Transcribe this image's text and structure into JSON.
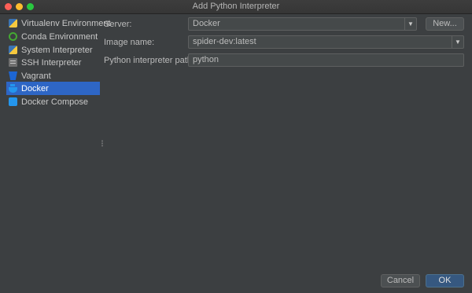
{
  "window": {
    "title": "Add Python Interpreter"
  },
  "sidebar": {
    "items": [
      {
        "label": "Virtualenv Environment",
        "icon": "python-icon"
      },
      {
        "label": "Conda Environment",
        "icon": "conda-icon"
      },
      {
        "label": "System Interpreter",
        "icon": "python-icon"
      },
      {
        "label": "SSH Interpreter",
        "icon": "ssh-icon"
      },
      {
        "label": "Vagrant",
        "icon": "vagrant-icon"
      },
      {
        "label": "Docker",
        "icon": "docker-icon",
        "selected": true
      },
      {
        "label": "Docker Compose",
        "icon": "docker-compose-icon"
      }
    ]
  },
  "form": {
    "server": {
      "label": "Server:",
      "value": "Docker"
    },
    "new_button": "New...",
    "image": {
      "label": "Image name:",
      "value": "spider-dev:latest"
    },
    "python_path": {
      "label": "Python interpreter path:",
      "value": "python"
    }
  },
  "footer": {
    "cancel": "Cancel",
    "ok": "OK"
  },
  "colors": {
    "background": "#3c3f41",
    "selection": "#2e66c5",
    "primary_button": "#365880",
    "field": "#45494a"
  }
}
